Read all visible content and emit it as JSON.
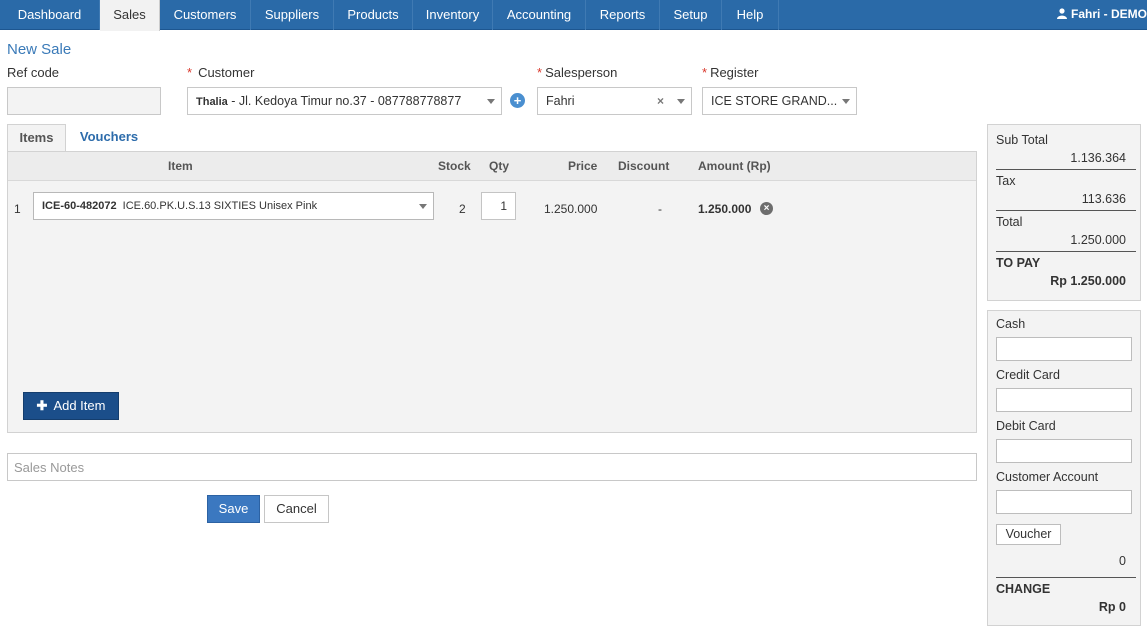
{
  "nav": {
    "tabs": [
      "Dashboard",
      "Sales",
      "Customers",
      "Suppliers",
      "Products",
      "Inventory",
      "Accounting",
      "Reports",
      "Setup",
      "Help"
    ],
    "active": "Sales",
    "user": "Fahri - DEMO"
  },
  "page": {
    "title": "New Sale"
  },
  "form": {
    "ref_code_label": "Ref code",
    "ref_code_value": "",
    "customer_label": "Customer",
    "customer_name": "Thalia",
    "customer_detail": " - Jl. Kedoya Timur no.37 - 087788778877",
    "salesperson_label": "Salesperson",
    "salesperson_value": "Fahri",
    "register_label": "Register",
    "register_value": "ICE STORE GRAND...",
    "required_mark": "*"
  },
  "tabs": {
    "items": "Items",
    "vouchers": "Vouchers"
  },
  "table": {
    "headers": {
      "item": "Item",
      "stock": "Stock",
      "qty": "Qty",
      "price": "Price",
      "discount": "Discount",
      "amount": "Amount (Rp)"
    },
    "rows": [
      {
        "num": "1",
        "code": "ICE-60-482072",
        "name": "ICE.60.PK.U.S.13 SIXTIES Unisex Pink",
        "stock": "2",
        "qty": "1",
        "price": "1.250.000",
        "discount": "-",
        "amount": "1.250.000"
      }
    ],
    "add_label": "Add Item"
  },
  "notes": {
    "placeholder": "Sales Notes"
  },
  "actions": {
    "save": "Save",
    "cancel": "Cancel"
  },
  "summary": {
    "subtotal_label": "Sub Total",
    "subtotal": "1.136.364",
    "tax_label": "Tax",
    "tax": "113.636",
    "total_label": "Total",
    "total": "1.250.000",
    "topay_label": "TO PAY",
    "topay": "Rp 1.250.000"
  },
  "payment": {
    "cash_label": "Cash",
    "credit_label": "Credit Card",
    "debit_label": "Debit Card",
    "account_label": "Customer Account",
    "voucher_label": "Voucher",
    "voucher_value": "0",
    "change_label": "CHANGE",
    "change_value": "Rp 0"
  },
  "colors": {
    "nav": "#2a6aa8",
    "primary": "#3b78c0",
    "add_button": "#1b4e8a",
    "required": "#d9372b"
  }
}
